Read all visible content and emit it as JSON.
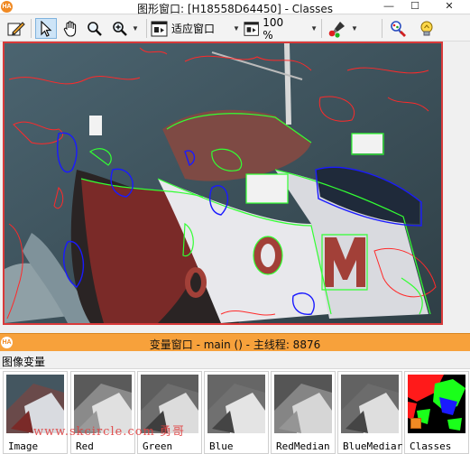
{
  "window": {
    "title": "图形窗口: [H18558D64450] - Classes",
    "app_badge": "HA",
    "minimize": "—",
    "maximize": "☐",
    "close": "✕"
  },
  "toolbar": {
    "zoom_mode_label": "适应窗口",
    "zoom_percent_label": "100 %"
  },
  "variable_window": {
    "title": "变量窗口 - main () - 主线程: 8876"
  },
  "iconic_vars": {
    "section_label": "图像变量",
    "items": [
      {
        "label": "Image"
      },
      {
        "label": "Red"
      },
      {
        "label": "Green"
      },
      {
        "label": "Blue"
      },
      {
        "label": "RedMedian"
      },
      {
        "label": "BlueMediar"
      },
      {
        "label": "Classes"
      }
    ]
  },
  "watermark": "www.skcircle.com 勇哥",
  "colors": {
    "title_bar": "#ffffff",
    "var_header": "#f7a13b",
    "graphics_border": "#d93a3a",
    "region_red": "#ff2a2a",
    "region_green": "#33ff33",
    "region_blue": "#1a1aff"
  }
}
